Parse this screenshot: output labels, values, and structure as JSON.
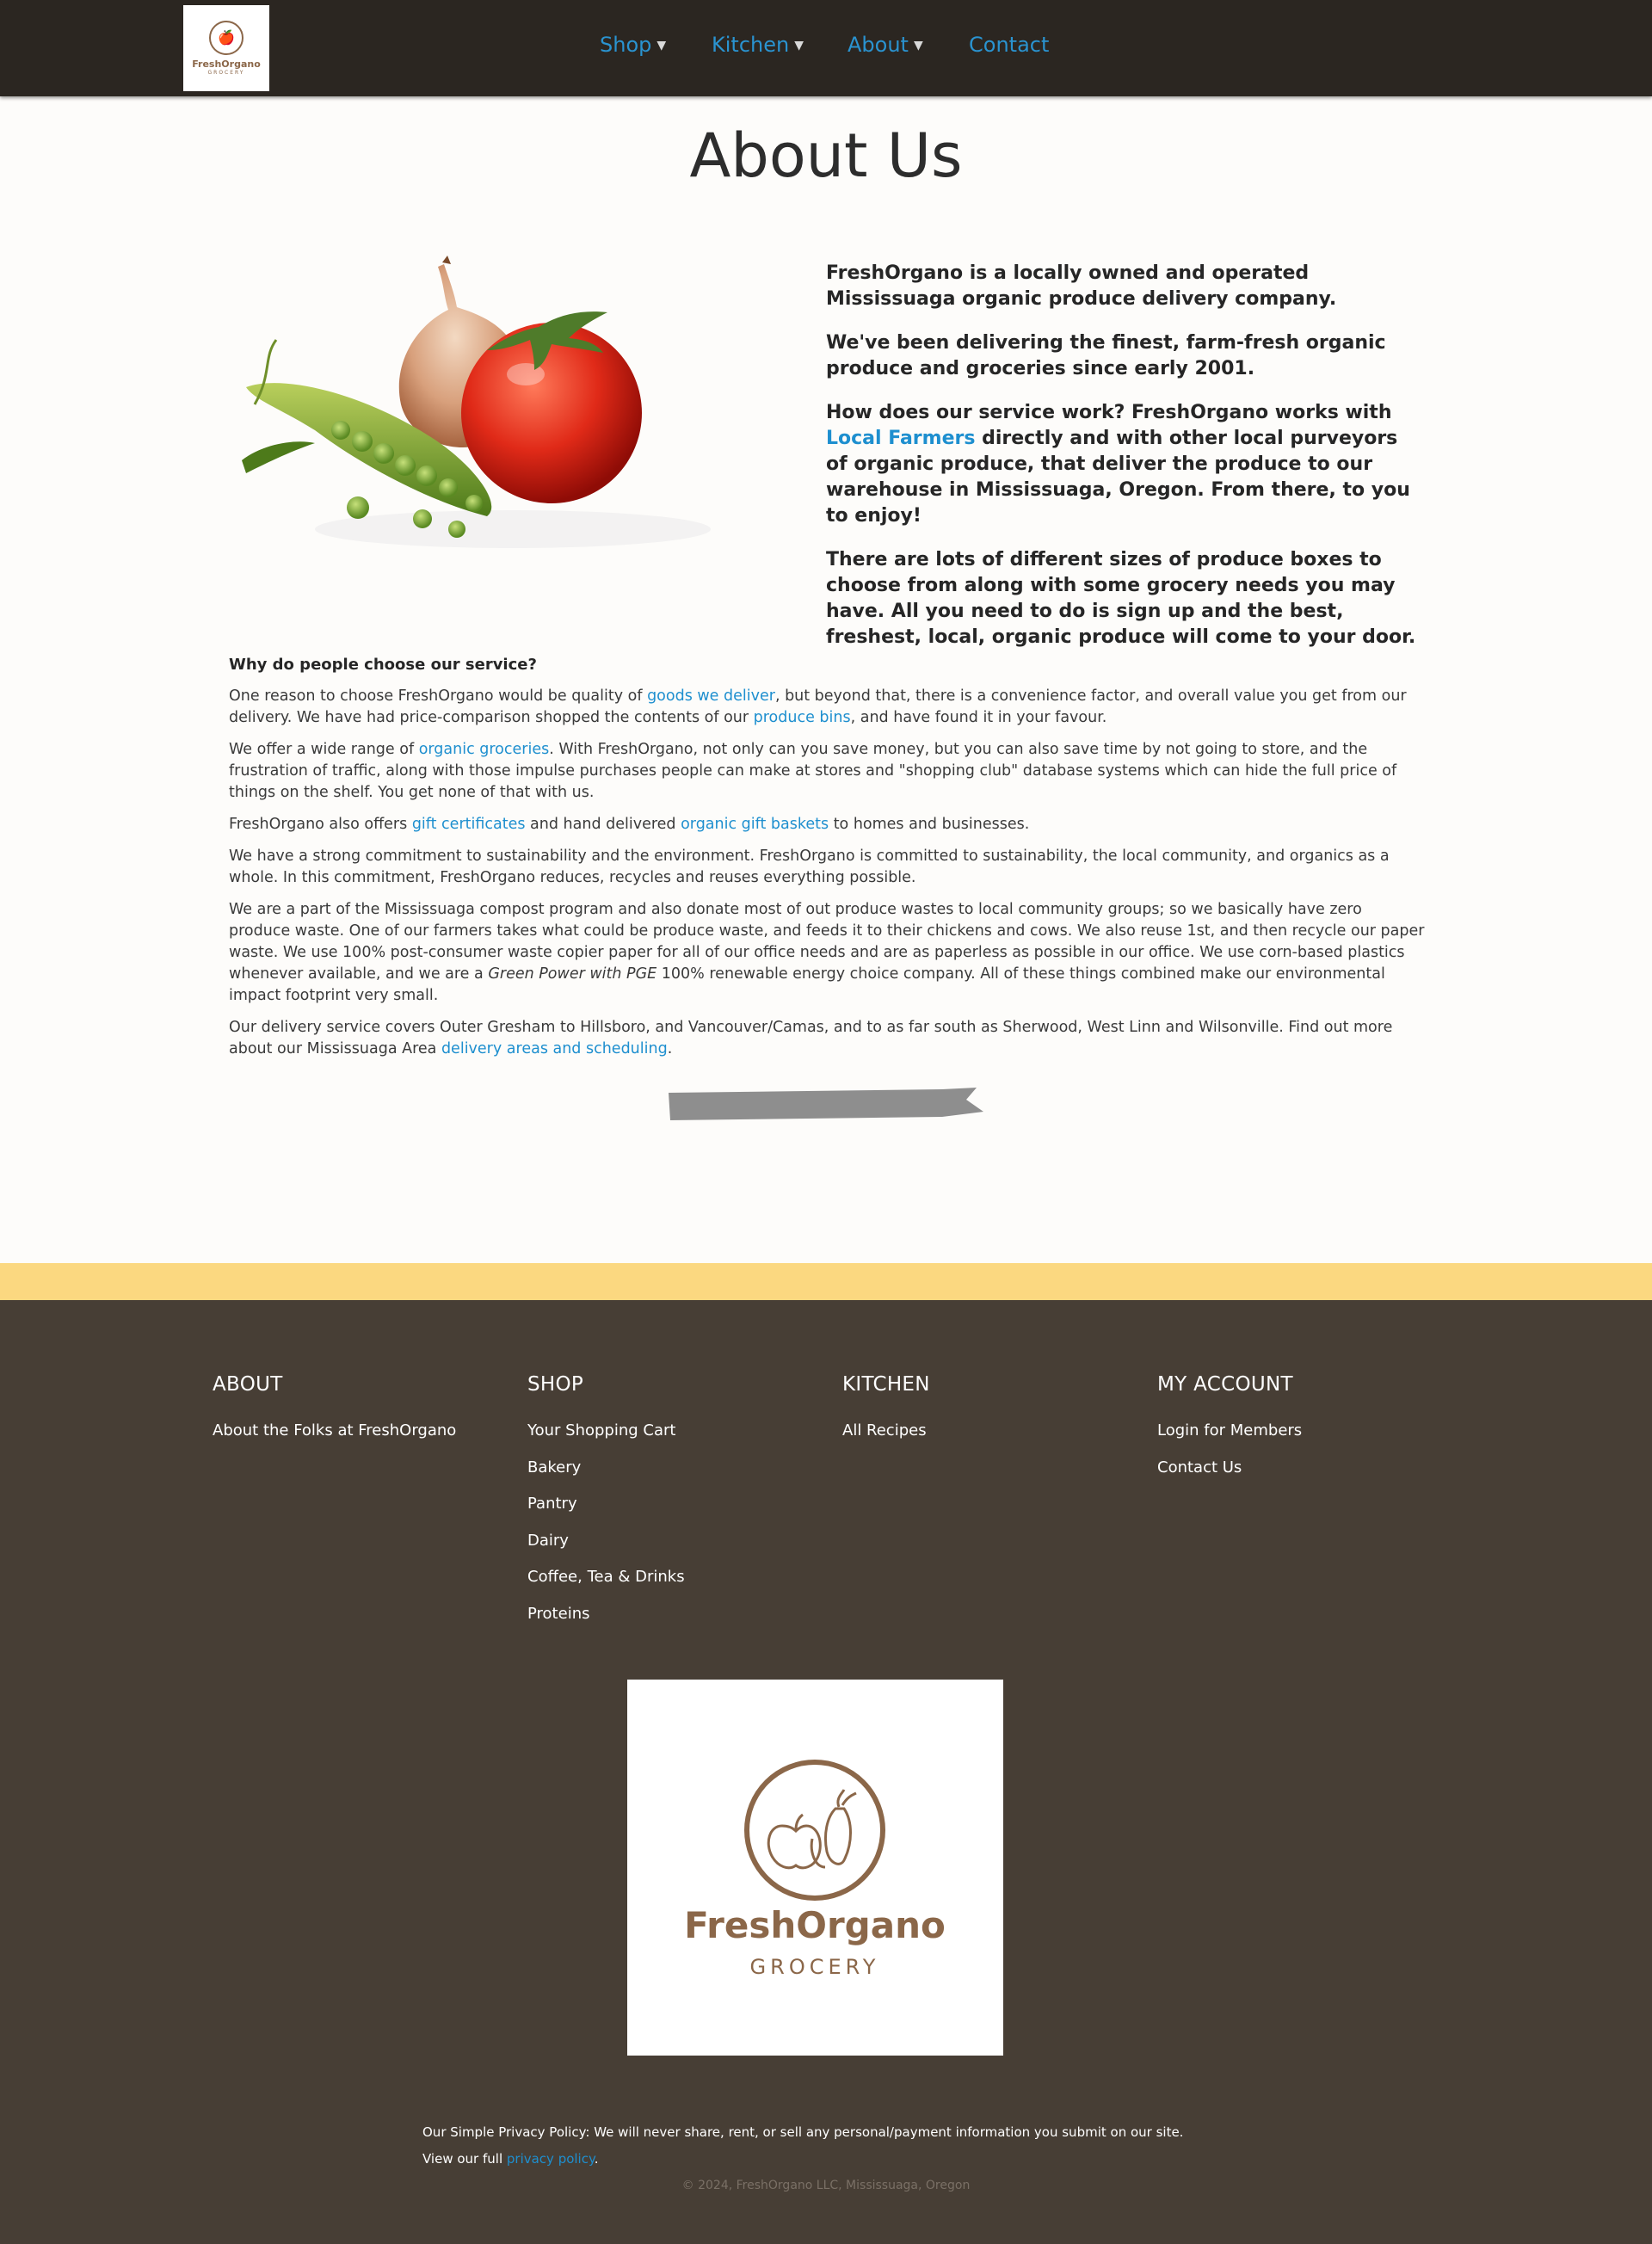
{
  "nav": {
    "logo": {
      "name": "FreshOrgano",
      "sub": "GROCERY"
    },
    "items": [
      {
        "label": "Shop",
        "has_caret": true
      },
      {
        "label": "Kitchen",
        "has_caret": true
      },
      {
        "label": "About",
        "has_caret": true
      },
      {
        "label": "Contact",
        "has_caret": false
      }
    ]
  },
  "page": {
    "title": "About Us"
  },
  "intro": {
    "p1": "FreshOrgano is a locally owned and operated Mississuaga organic produce delivery company.",
    "p2": "We've been delivering the finest, farm-fresh organic produce and groceries since early 2001.",
    "p3_before": "How does our service work? FreshOrgano works with ",
    "p3_link": "Local Farmers",
    "p3_after": " directly and with other local purveyors of organic produce, that deliver the produce to our warehouse in Mississuaga, Oregon. From there, to you to enjoy!",
    "p4": "There are lots of different sizes of produce boxes to choose from along with some grocery needs you may have. All you need to do is sign up and the best, freshest, local, organic produce will come to your door."
  },
  "content": {
    "heading": "Why do people choose our service?",
    "para1": {
      "t1": "One reason to choose FreshOrgano would be quality of ",
      "l1": "goods we deliver",
      "t2": ", but beyond that, there is a convenience factor, and overall value you get from our delivery. We have had price-comparison shopped the contents of our ",
      "l2": "produce bins",
      "t3": ", and have found it in your favour."
    },
    "para2": {
      "t1": "We offer a wide range of ",
      "l1": "organic groceries",
      "t2": ". With FreshOrgano, not only can you save money, but you can also save time by not going to store, and the frustration of traffic, along with those impulse purchases people can make at stores and \"shopping club\" database systems which can hide the full price of things on the shelf. You get none of that with us."
    },
    "para3": {
      "t1": "FreshOrgano also offers ",
      "l1": "gift certificates",
      "t2": " and hand delivered ",
      "l2": "organic gift baskets",
      "t3": " to homes and businesses."
    },
    "para4": "We have a strong commitment to sustainability and the environment. FreshOrgano is committed to sustainability, the local community, and organics as a whole. In this commitment, FreshOrgano reduces, recycles and reuses everything possible.",
    "para5": {
      "t1": "We are a part of the Mississuaga compost program and also donate most of out produce wastes to local community groups; so we basically have zero produce waste. One of our farmers takes what could be produce waste, and feeds it to their chickens and cows. We also reuse 1st, and then recycle our paper waste. We use 100% post-consumer waste copier paper for all of our office needs and are as paperless as possible in our office. We use corn-based plastics whenever available, and we are a ",
      "em": "Green Power with PGE",
      "t2": " 100% renewable energy choice company. All of these things combined make our environmental impact footprint very small."
    },
    "para6": {
      "t1": "Our delivery service covers Outer Gresham to Hillsboro, and Vancouver/Camas, and to as far south as Sherwood, West Linn and Wilsonville. Find out more about our Mississuaga Area ",
      "l1": "delivery areas and scheduling",
      "t2": "."
    }
  },
  "footer": {
    "columns": [
      {
        "title": "ABOUT",
        "links": [
          "About the Folks at FreshOrgano"
        ]
      },
      {
        "title": "SHOP",
        "links": [
          "Your Shopping Cart",
          "Bakery",
          "Pantry",
          "Dairy",
          "Coffee, Tea & Drinks",
          "Proteins"
        ]
      },
      {
        "title": "KITCHEN",
        "links": [
          "All Recipes"
        ]
      },
      {
        "title": "MY ACCOUNT",
        "links": [
          "Login for Members",
          "Contact Us"
        ]
      }
    ],
    "logo": {
      "name": "FreshOrgano",
      "sub": "GROCERY"
    },
    "privacy_line1": "Our Simple Privacy Policy: We will never share, rent, or sell any personal/payment information you submit on our site.",
    "privacy_line2_before": "View our full ",
    "privacy_link": "privacy policy",
    "privacy_line2_after": ".",
    "copyright": "© 2024, FreshOrgano LLC, Mississuaga, Oregon"
  },
  "colors": {
    "nav_bg": "#2b2621",
    "link": "#1e8fcf",
    "footer_band": "#fbd880",
    "footer_bg": "#473e35",
    "brand_brown": "#8b6749"
  }
}
